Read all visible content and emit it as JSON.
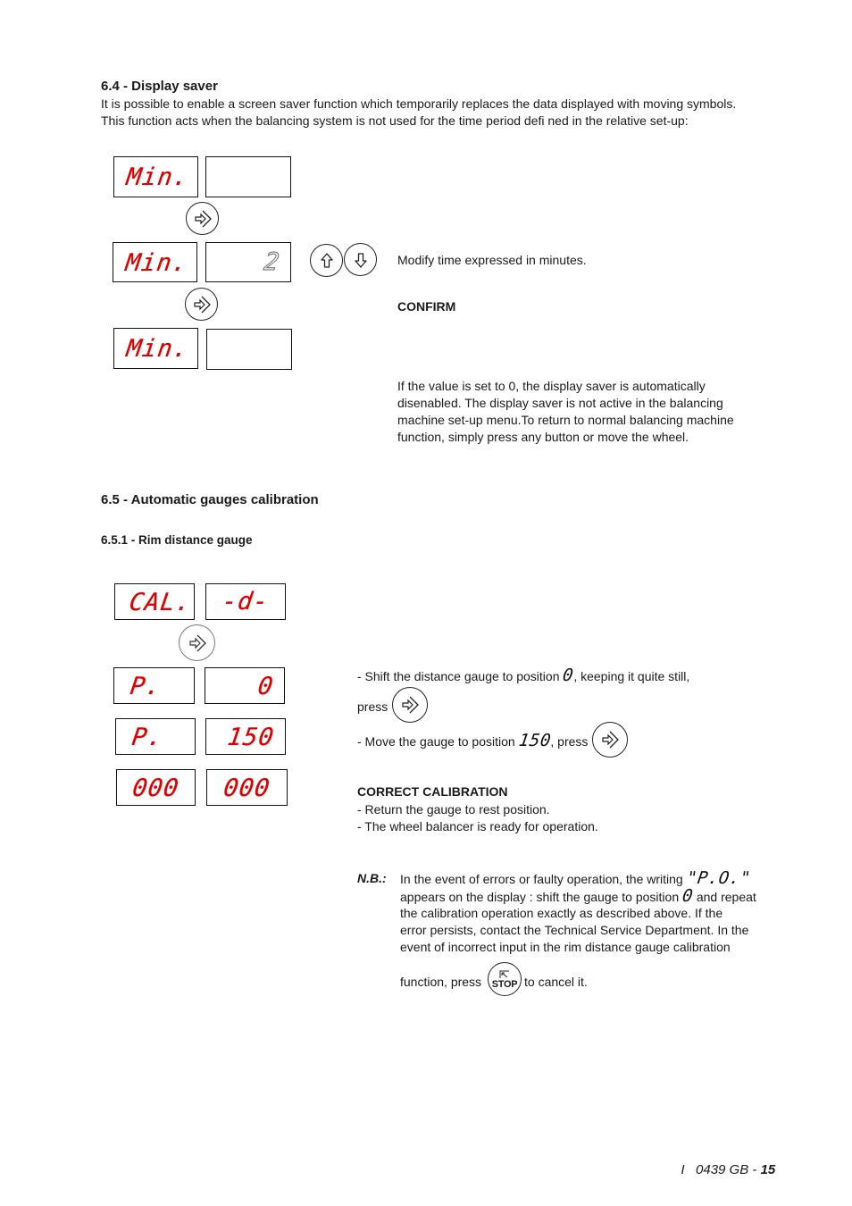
{
  "section_6_4": {
    "heading": "6.4 - Display saver",
    "intro_line1": "It is possible to enable a screen saver function which temporarily replaces the data displayed with moving symbols.",
    "intro_line2": "This function acts when the balancing system is not used for the time period defi ned in the relative set-up:",
    "displays": [
      {
        "left": "Min.",
        "right": ""
      },
      {
        "left": "Min.",
        "right": "2"
      },
      {
        "left": "Min.",
        "right": ""
      }
    ],
    "modify_text": "Modify time expressed in minutes.",
    "confirm_label": "CONFIRM",
    "note_lines": [
      "If the value is set to 0, the display saver is automatically",
      "disenabled. The display saver is not active in the balancing",
      "machine set-up menu.To return to normal balancing machine",
      "function, simply press any button or move the wheel."
    ],
    "icons": {
      "enter": "enter-arrow-icon",
      "up": "up-arrow-icon",
      "down": "down-arrow-icon",
      "stop": "stop-icon"
    }
  },
  "section_6_5": {
    "heading": "6.5 - Automatic gauges calibration",
    "subheading": "6.5.1 - Rim distance gauge",
    "displays": [
      {
        "left": "CAL.",
        "right": "-d-"
      },
      {
        "left": "P.",
        "right": "0"
      },
      {
        "left": "P.",
        "right": "150"
      },
      {
        "left": "000",
        "right": "000"
      }
    ],
    "step1_a": "- Shift the distance gauge to position ",
    "step1_value": "0",
    "step1_b": ", keeping it quite still,",
    "step1_press": "press",
    "step2_a": "- Move the gauge to position ",
    "step2_value": "150",
    "step2_b": ", press",
    "correct_heading": "CORRECT CALIBRATION",
    "correct_lines": [
      "- Return the gauge to rest position.",
      "- The wheel balancer is ready for operation."
    ],
    "nb_label": "N.B.:",
    "nb_line1_a": "In the event of errors or faulty operation, the writing ",
    "nb_line1_value": "\"P.O.\"",
    "nb_line2_a": "appears on the display : shift the gauge to position ",
    "nb_line2_value": "0",
    "nb_line2_b": " and repeat",
    "nb_lines": [
      "the calibration operation exactly as described above. If the",
      "error persists, contact the Technical Service Department. In the",
      "event of incorrect input in the rim distance gauge calibration"
    ],
    "nb_last_a": "function, press ",
    "stop_label": "STOP",
    "nb_last_b": " to cancel it."
  },
  "footer": {
    "prefix": "I   0439 GB - ",
    "page": "15"
  }
}
